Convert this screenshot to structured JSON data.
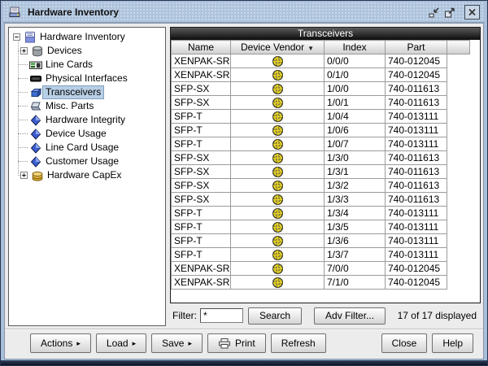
{
  "window": {
    "title": "Hardware Inventory"
  },
  "tree": {
    "items": [
      {
        "label": "Hardware Inventory",
        "level": 0,
        "expander": "minus",
        "icon": "inventory-icon"
      },
      {
        "label": "Devices",
        "level": 1,
        "expander": "plus",
        "icon": "devices-icon"
      },
      {
        "label": "Line Cards",
        "level": 1,
        "icon": "line-card-icon"
      },
      {
        "label": "Physical Interfaces",
        "level": 1,
        "icon": "physical-interface-icon"
      },
      {
        "label": "Transceivers",
        "level": 1,
        "icon": "transceiver-icon",
        "selected": true
      },
      {
        "label": "Misc. Parts",
        "level": 1,
        "icon": "misc-parts-icon"
      },
      {
        "label": "Hardware Integrity",
        "level": 1,
        "icon": "usage-diamond-icon"
      },
      {
        "label": "Device Usage",
        "level": 1,
        "icon": "usage-diamond-icon"
      },
      {
        "label": "Line Card Usage",
        "level": 1,
        "icon": "usage-diamond-icon"
      },
      {
        "label": "Customer Usage",
        "level": 1,
        "icon": "usage-diamond-icon"
      },
      {
        "label": "Hardware CapEx",
        "level": 1,
        "expander": "plus",
        "icon": "capex-icon"
      }
    ]
  },
  "panel": {
    "header": "Transceivers"
  },
  "table": {
    "columns": [
      {
        "label": "Name"
      },
      {
        "label": "Device Vendor",
        "sort": "desc"
      },
      {
        "label": "Index"
      },
      {
        "label": "Part"
      },
      {
        "label": ""
      }
    ],
    "sort_arrow": "▼",
    "vendor_icon": "juniper-vendor-logo-icon",
    "rows": [
      {
        "name": "XENPAK-SR",
        "index": "0/0/0",
        "part": "740-012045"
      },
      {
        "name": "XENPAK-SR",
        "index": "0/1/0",
        "part": "740-012045"
      },
      {
        "name": "SFP-SX",
        "index": "1/0/0",
        "part": "740-011613"
      },
      {
        "name": "SFP-SX",
        "index": "1/0/1",
        "part": "740-011613"
      },
      {
        "name": "SFP-T",
        "index": "1/0/4",
        "part": "740-013111"
      },
      {
        "name": "SFP-T",
        "index": "1/0/6",
        "part": "740-013111"
      },
      {
        "name": "SFP-T",
        "index": "1/0/7",
        "part": "740-013111"
      },
      {
        "name": "SFP-SX",
        "index": "1/3/0",
        "part": "740-011613"
      },
      {
        "name": "SFP-SX",
        "index": "1/3/1",
        "part": "740-011613"
      },
      {
        "name": "SFP-SX",
        "index": "1/3/2",
        "part": "740-011613"
      },
      {
        "name": "SFP-SX",
        "index": "1/3/3",
        "part": "740-011613"
      },
      {
        "name": "SFP-T",
        "index": "1/3/4",
        "part": "740-013111"
      },
      {
        "name": "SFP-T",
        "index": "1/3/5",
        "part": "740-013111"
      },
      {
        "name": "SFP-T",
        "index": "1/3/6",
        "part": "740-013111"
      },
      {
        "name": "SFP-T",
        "index": "1/3/7",
        "part": "740-013111"
      },
      {
        "name": "XENPAK-SR",
        "index": "7/0/0",
        "part": "740-012045"
      },
      {
        "name": "XENPAK-SR",
        "index": "7/1/0",
        "part": "740-012045"
      }
    ]
  },
  "filter": {
    "label": "Filter:",
    "value": "*",
    "search_label": "Search",
    "adv_label": "Adv Filter...",
    "status": "17 of 17 displayed"
  },
  "toolbar": {
    "menu_arrow": "▸",
    "actions_label": "Actions",
    "load_label": "Load",
    "save_label": "Save",
    "print_label": "Print",
    "refresh_label": "Refresh",
    "close_label": "Close",
    "help_label": "Help"
  },
  "colors": {
    "selection": "#B8CFE5",
    "titlebar": "#A9BFD9",
    "panel_header_bg": "#1A1A1A",
    "vendor_yellow": "#E8D21F"
  }
}
